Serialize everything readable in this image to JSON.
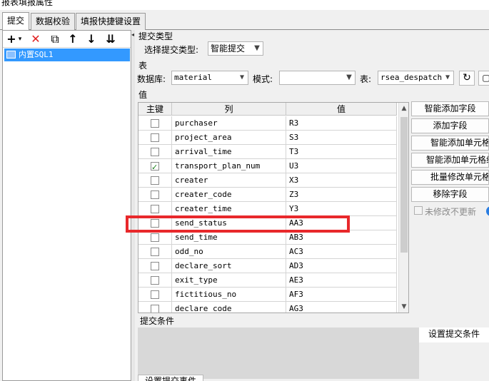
{
  "window": {
    "title": "报表填报属性"
  },
  "tabs": [
    {
      "label": "提交",
      "active": true
    },
    {
      "label": "数据校验",
      "active": false
    },
    {
      "label": "填报快捷键设置",
      "active": false
    }
  ],
  "left_toolbar": {
    "add": "+",
    "add_dropdown": "▾",
    "delete": "✕",
    "copy": "⧉",
    "up": "↑",
    "down": "↓",
    "sort": "⇊"
  },
  "tree": {
    "items": [
      {
        "label": "内置SQL1"
      }
    ]
  },
  "submit_type": {
    "section_label": "提交类型",
    "select_label": "选择提交类型:",
    "value": "智能提交"
  },
  "table_section": {
    "section_label": "表",
    "db_label": "数据库:",
    "db_value": "material",
    "schema_label": "模式:",
    "schema_value": "",
    "table_label": "表:",
    "table_value": "rsea_despatch"
  },
  "values_section": {
    "section_label": "值",
    "columns": [
      "主键",
      "列",
      "值"
    ],
    "rows": [
      {
        "key": false,
        "column": "purchaser",
        "value": "R3"
      },
      {
        "key": false,
        "column": "project_area",
        "value": "S3"
      },
      {
        "key": false,
        "column": "arrival_time",
        "value": "T3"
      },
      {
        "key": true,
        "column": "transport_plan_num",
        "value": "U3"
      },
      {
        "key": false,
        "column": "creater",
        "value": "X3"
      },
      {
        "key": false,
        "column": "creater_code",
        "value": "Z3"
      },
      {
        "key": false,
        "column": "creater_time",
        "value": "Y3"
      },
      {
        "key": false,
        "column": "send_status",
        "value": "AA3"
      },
      {
        "key": false,
        "column": "send_time",
        "value": "AB3"
      },
      {
        "key": false,
        "column": "odd_no",
        "value": "AC3"
      },
      {
        "key": false,
        "column": "declare_sort",
        "value": "AD3"
      },
      {
        "key": false,
        "column": "exit_type",
        "value": "AE3"
      },
      {
        "key": false,
        "column": "fictitious_no",
        "value": "AF3"
      },
      {
        "key": false,
        "column": "declare_code",
        "value": "AG3"
      }
    ]
  },
  "side_buttons": {
    "smart_add_field": "智能添加字段",
    "add_field": "添加字段",
    "smart_add_cell": "智能添加单元格",
    "smart_add_cell_group": "智能添加单元格组",
    "batch_edit_cell": "批量修改单元格",
    "remove_field": "移除字段",
    "no_update_unmodified": "未修改不更新",
    "help": "?"
  },
  "condition_section": {
    "section_label": "提交条件",
    "set_button": "设置提交条件",
    "bottom_button": "设置提交事件"
  },
  "colors": {
    "highlight": "#e8282b",
    "selection": "#3399ff",
    "check": "#1a7f1a"
  }
}
